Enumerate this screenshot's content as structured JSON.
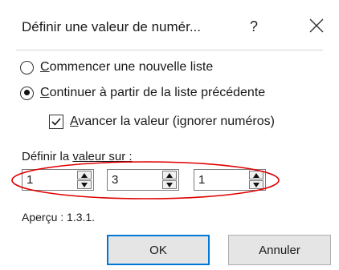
{
  "dialog": {
    "title": "Définir une valeur de numér...",
    "help_glyph": "?",
    "close_icon": "close-icon"
  },
  "options": {
    "new_list": {
      "underline": "C",
      "rest": "ommencer une nouvelle liste",
      "selected": false
    },
    "continue_list": {
      "underline": "C",
      "rest": "ontinuer à partir de la liste précédente",
      "selected": true
    },
    "advance": {
      "underline": "A",
      "rest": "vancer la valeur (ignorer numéros)",
      "checked": true
    }
  },
  "set_value": {
    "label_pre": "Définir la ",
    "label_underline": "v",
    "label_post": "aleur sur :",
    "fields": [
      "1",
      "3",
      "1"
    ]
  },
  "preview": "Aperçu : 1.3.1.",
  "buttons": {
    "ok": "OK",
    "cancel": "Annuler"
  },
  "colors": {
    "highlight_ellipse": "#e00000",
    "default_button_border": "#0078d7"
  }
}
